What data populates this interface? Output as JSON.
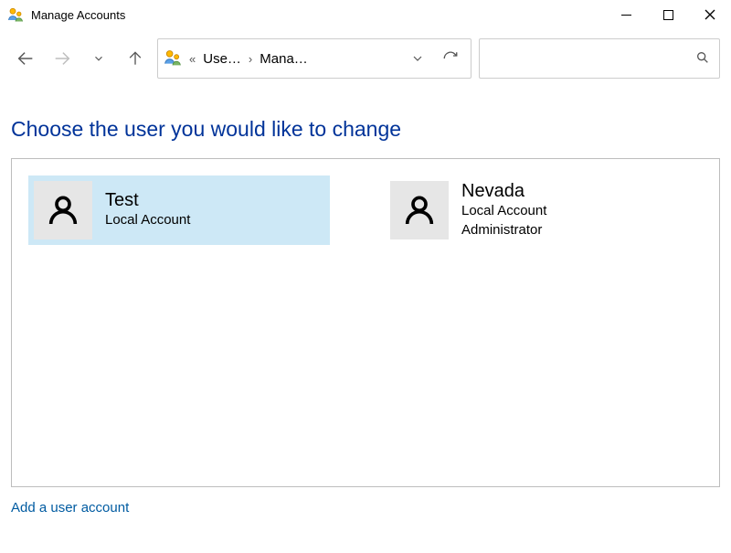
{
  "title": "Manage Accounts",
  "breadcrumb": {
    "seg1": "Use…",
    "seg2": "Mana…"
  },
  "heading": "Choose the user you would like to change",
  "accounts": [
    {
      "name": "Test",
      "line1": "Local Account",
      "line2": "",
      "selected": true
    },
    {
      "name": "Nevada",
      "line1": "Local Account",
      "line2": "Administrator",
      "selected": false
    }
  ],
  "footer_link": "Add a user account",
  "search": {
    "placeholder": ""
  }
}
